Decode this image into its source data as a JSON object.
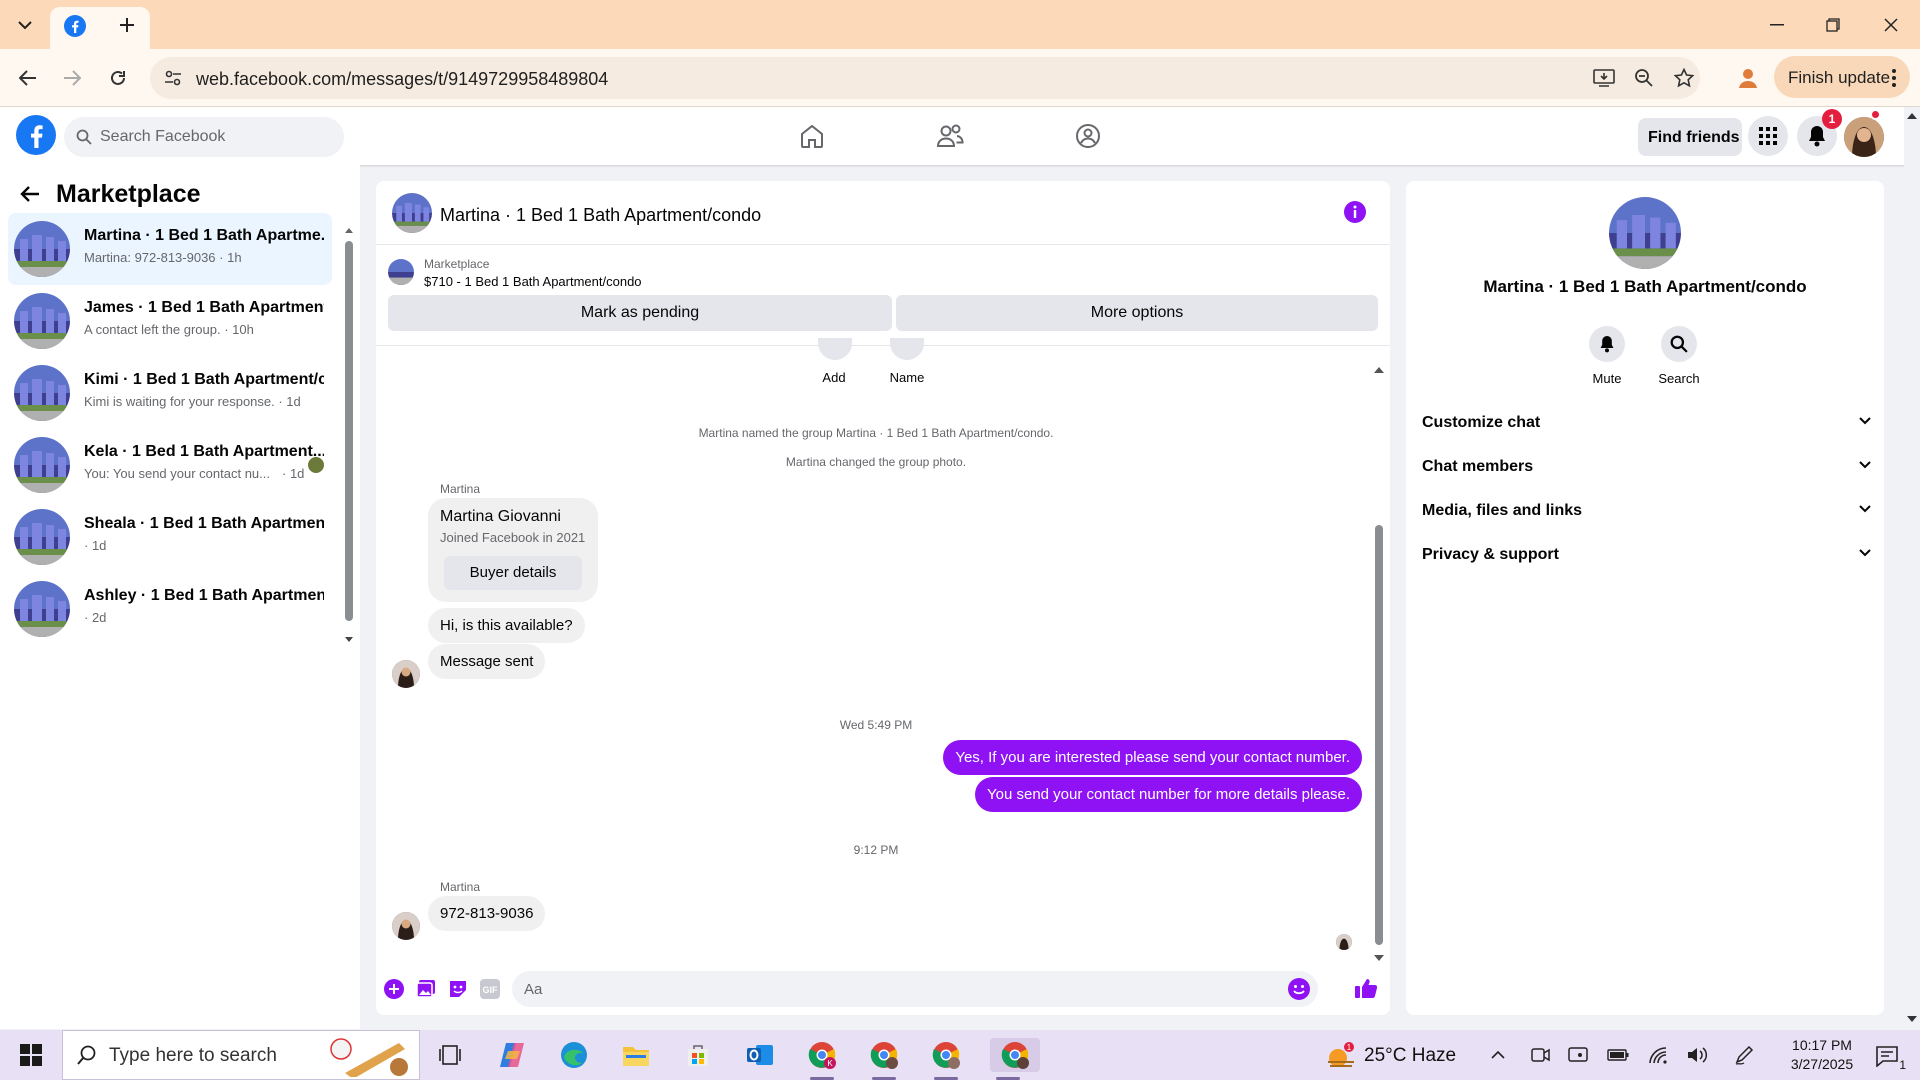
{
  "browser": {
    "url": "web.facebook.com/messages/t/9149729958489804",
    "finish_update": "Finish update"
  },
  "facebook": {
    "search_placeholder": "Search Facebook",
    "find_friends": "Find friends",
    "notification_count": "1",
    "brand_color": "#1877f2"
  },
  "sidebar": {
    "title": "Marketplace",
    "conversations": [
      {
        "title": "Martina · 1 Bed 1 Bath Apartme...",
        "subtitle": "Martina: 972-813-9036 · 1h",
        "active": true
      },
      {
        "title": "James · 1 Bed 1 Bath Apartment...",
        "subtitle": "A contact left the group. · 10h"
      },
      {
        "title": "Kimi · 1 Bed 1 Bath Apartment/c...",
        "subtitle": "Kimi is waiting for your response. · 1d"
      },
      {
        "title": "Kela · 1 Bed 1 Bath Apartment...",
        "subtitle": "You: You send your contact nu...",
        "time": "· 1d"
      },
      {
        "title": "Sheala · 1 Bed 1 Bath Apartment...",
        "subtitle": "· 1d"
      },
      {
        "title": "Ashley · 1 Bed 1 Bath Apartment...",
        "subtitle": "· 2d"
      }
    ]
  },
  "chat": {
    "title": "Martina · 1 Bed 1 Bath Apartment/condo",
    "marketplace_label": "Marketplace",
    "listing": "$710 - 1 Bed 1 Bath Apartment/condo",
    "mark_pending": "Mark as pending",
    "more_options": "More options",
    "add_label": "Add",
    "name_label": "Name",
    "system_1": "Martina named the group Martina · 1 Bed 1 Bath Apartment/condo.",
    "system_2": "Martina changed the group photo.",
    "sender_1": "Martina",
    "card_name": "Martina Giovanni",
    "card_joined": "Joined Facebook in 2021",
    "buyer_details": "Buyer details",
    "msg_1": "Hi, is this available?",
    "msg_2": "Message sent",
    "time_1": "Wed 5:49 PM",
    "my_msg_1": "Yes, If you are interested please send your contact number.",
    "my_msg_2": "You send your contact number for more details please.",
    "time_2": "9:12 PM",
    "sender_2": "Martina",
    "msg_3": "972-813-9036",
    "composer_placeholder": "Aa",
    "accent_color": "#8f12f5"
  },
  "info": {
    "name": "Martina · 1 Bed 1 Bath Apartment/condo",
    "mute": "Mute",
    "search": "Search",
    "sections": [
      "Customize chat",
      "Chat members",
      "Media, files and links",
      "Privacy & support"
    ]
  },
  "taskbar": {
    "search_placeholder": "Type here to search",
    "weather": "25°C  Haze",
    "time": "10:17 PM",
    "date": "3/27/2025",
    "weather_badge": "1",
    "notification_count": "1"
  }
}
